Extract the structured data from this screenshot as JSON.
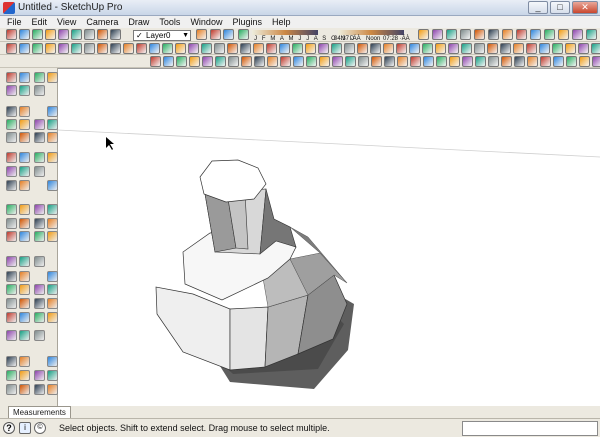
{
  "window": {
    "title": "Untitled - SketchUp Pro",
    "minimize": "_",
    "maximize": "□",
    "close": "✕"
  },
  "menu": [
    "File",
    "Edit",
    "View",
    "Camera",
    "Draw",
    "Tools",
    "Window",
    "Plugins",
    "Help"
  ],
  "layer": {
    "current": "Layer0",
    "check": "✓",
    "arrow": "▼"
  },
  "shadows": {
    "months": "J F M A M J J A S O N D",
    "time_start": "04:37 ·ÄÀ",
    "time_mid": "Noon",
    "time_end": "07:28 ·ÄÀ"
  },
  "colors": {
    "accent": "#2266cc",
    "toolbar": "#ece9e0",
    "model_light": "#f3f3f3",
    "model_shade": "#8a8a8a",
    "shadow": "#666666"
  },
  "measurements": {
    "label": "Measurements",
    "value": ""
  },
  "status": {
    "help_icon": "?",
    "info_icon": "i",
    "geo_icon": "©",
    "message": "Select objects. Shift to extend select. Drag mouse to select multiple."
  }
}
